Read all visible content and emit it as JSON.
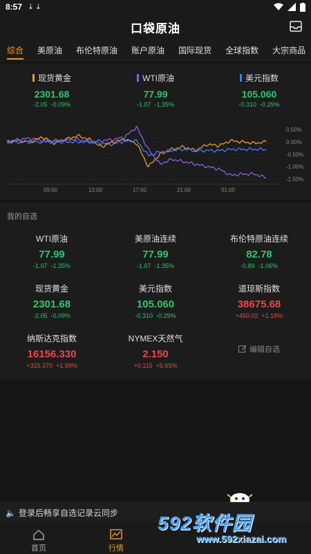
{
  "statusbar": {
    "time": "8:57"
  },
  "app": {
    "logo": "口袋原油"
  },
  "tabs": [
    "综合",
    "美原油",
    "布伦特原油",
    "账户原油",
    "国际现货",
    "全球指数",
    "大宗商品"
  ],
  "top_quotes": [
    {
      "name": "现货黄金",
      "color": "#f29b2b",
      "price": "2301.68",
      "change": "-2.05",
      "pct": "-0.09%"
    },
    {
      "name": "WTI原油",
      "color": "#8b5cf6",
      "price": "77.99",
      "change": "-1.07",
      "pct": "-1.35%"
    },
    {
      "name": "美元指数",
      "color": "#3b82f6",
      "price": "105.060",
      "change": "-0.310",
      "pct": "-0.29%"
    }
  ],
  "chart_data": {
    "type": "line",
    "x_ticks": [
      "09:00",
      "13:00",
      "17:00",
      "21:00",
      "01:00"
    ],
    "y_ticks": [
      "0.50%",
      "0.00%",
      "-0.50%",
      "-1.00%",
      "-1.50%"
    ],
    "ylim": [
      -1.6,
      0.7
    ],
    "series": [
      {
        "name": "现货黄金",
        "color": "#f29b2b",
        "values": [
          0.0,
          0.05,
          0.0,
          0.2,
          -0.05,
          0.1,
          0.25,
          0.1,
          -0.2,
          0.0,
          0.1,
          -0.05,
          -1.0,
          -0.5,
          -0.3,
          -0.2,
          -0.35,
          -0.1,
          -0.15,
          0.05,
          0.0,
          -0.05,
          0.0
        ]
      },
      {
        "name": "WTI原油",
        "color": "#8b5cf6",
        "values": [
          0.0,
          0.1,
          0.15,
          0.05,
          0.05,
          0.1,
          0.1,
          0.0,
          0.05,
          0.1,
          0.2,
          0.6,
          -0.3,
          -0.9,
          -0.7,
          -0.8,
          -0.9,
          -1.0,
          -1.1,
          -1.35,
          -1.3,
          -1.3,
          -1.45
        ]
      },
      {
        "name": "美元指数",
        "color": "#3b82f6",
        "values": [
          0.0,
          0.0,
          0.0,
          0.0,
          0.0,
          0.0,
          0.0,
          0.0,
          -0.05,
          -0.1,
          0.05,
          0.05,
          -0.55,
          -0.4,
          -0.35,
          -0.3,
          -0.35,
          -0.35,
          -0.35,
          -0.3,
          -0.3,
          -0.3,
          -0.3
        ]
      }
    ]
  },
  "watchlist": {
    "title": "我的自选",
    "items": [
      {
        "name": "WTI原油",
        "price": "77.99",
        "change": "-1.07",
        "pct": "-1.35%",
        "dir": "down"
      },
      {
        "name": "美原油连续",
        "price": "77.99",
        "change": "-1.07",
        "pct": "-1.35%",
        "dir": "down"
      },
      {
        "name": "布伦特原油连续",
        "price": "82.78",
        "change": "-0.89",
        "pct": "-1.06%",
        "dir": "down"
      },
      {
        "name": "现货黄金",
        "price": "2301.68",
        "change": "-2.05",
        "pct": "-0.09%",
        "dir": "down"
      },
      {
        "name": "美元指数",
        "price": "105.060",
        "change": "-0.310",
        "pct": "-0.29%",
        "dir": "down"
      },
      {
        "name": "道琼斯指数",
        "price": "38675.68",
        "change": "+450.02",
        "pct": "+1.18%",
        "dir": "up"
      },
      {
        "name": "纳斯达克指数",
        "price": "16156.330",
        "change": "+315.370",
        "pct": "+1.99%",
        "dir": "up"
      },
      {
        "name": "NYMEX天然气",
        "price": "2.150",
        "change": "+0.115",
        "pct": "+5.65%",
        "dir": "up"
      }
    ],
    "edit_label": "编辑自选"
  },
  "banner": {
    "text": "登录后畅享自选记录云同步"
  },
  "nav": [
    {
      "label": "首页",
      "icon": "home-icon"
    },
    {
      "label": "行情",
      "icon": "market-icon"
    }
  ],
  "watermark": {
    "big": "592软件园",
    "small": "www.592xiazai.com"
  }
}
